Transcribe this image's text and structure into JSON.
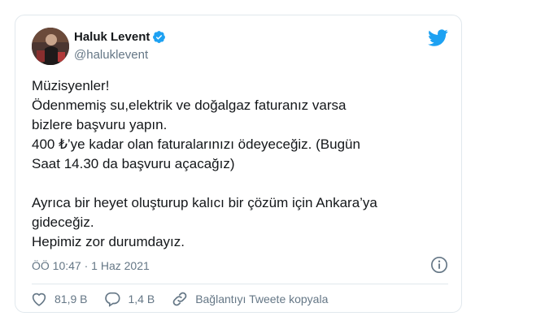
{
  "tweet": {
    "author_name": "Haluk Levent",
    "handle": "@haluklevent",
    "text": "Müzisyenler!\nÖdenmemiş su,elektrik ve doğalgaz faturanız varsa\nbizlere başvuru yapın.\n400 ₺’ye kadar olan faturalarınızı ödeyeceğiz. (Bugün\nSaat 14.30 da başvuru açacağız)\n\nAyrıca bir heyet oluşturup kalıcı bir çözüm için Ankara’ya\ngideceğiz.\nHepimiz zor durumdayız.",
    "time": "ÖÖ 10:47",
    "separator": " · ",
    "date": "1 Haz 2021"
  },
  "actions": {
    "likes": "81,9 B",
    "replies": "1,4 B",
    "copy_link_label": "Bağlantıyı Tweete kopyala"
  },
  "icons": {
    "verified": "verified-badge-icon",
    "brand": "twitter-bird-icon",
    "info": "info-icon",
    "like": "heart-icon",
    "reply": "reply-bubble-icon",
    "link": "link-icon"
  },
  "colors": {
    "accent": "#1da1f2",
    "text": "#14171a",
    "muted": "#657786",
    "border": "#e1e8ed"
  }
}
